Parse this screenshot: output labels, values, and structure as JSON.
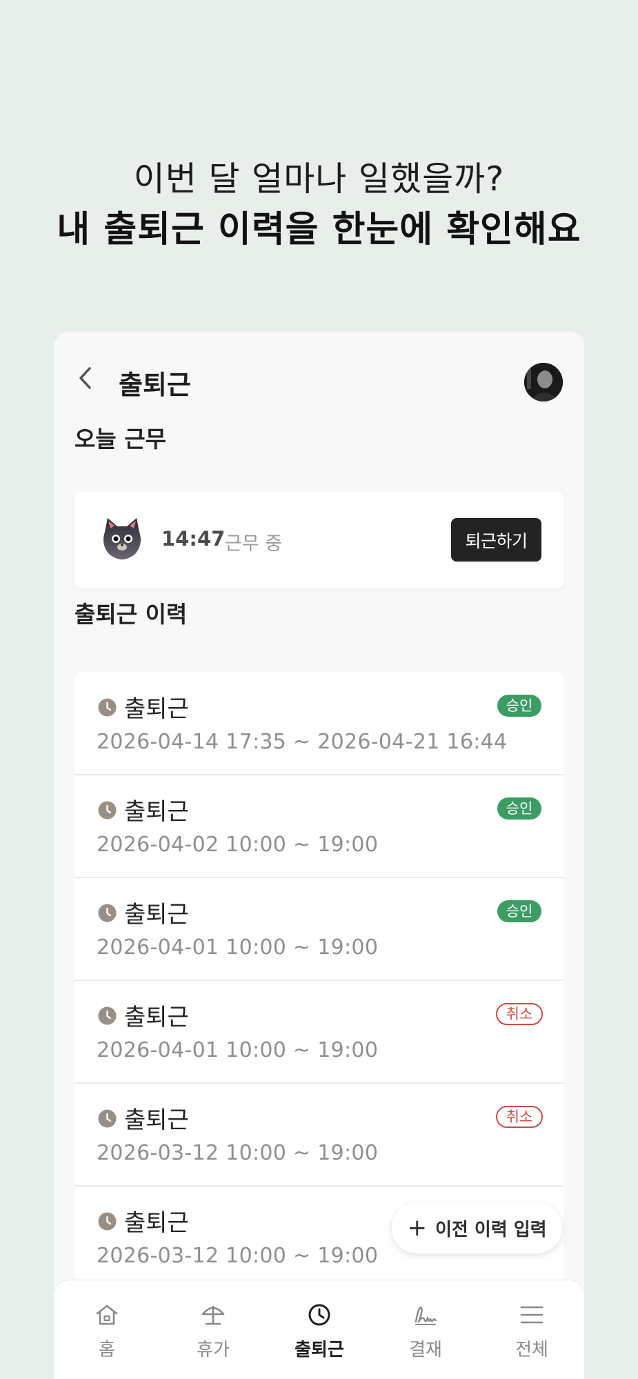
{
  "headline": {
    "line1": "이번 달 얼마나 일했을까?",
    "line2": "내 출퇴근 이력을 한눈에 확인해요"
  },
  "header": {
    "title": "출퇴근"
  },
  "today": {
    "section_title": "오늘 근무",
    "time": "14:47",
    "status": "근무 중",
    "leave_button": "퇴근하기"
  },
  "history": {
    "section_title": "출퇴근 이력",
    "rows": [
      {
        "title": "출퇴근",
        "date": "2026-04-14 17:35 ~ 2026-04-21 16:44",
        "badge": "승인",
        "badge_type": "approved"
      },
      {
        "title": "출퇴근",
        "date": "2026-04-02 10:00 ~ 19:00",
        "badge": "승인",
        "badge_type": "approved"
      },
      {
        "title": "출퇴근",
        "date": "2026-04-01 10:00 ~ 19:00",
        "badge": "승인",
        "badge_type": "approved"
      },
      {
        "title": "출퇴근",
        "date": "2026-04-01 10:00 ~ 19:00",
        "badge": "취소",
        "badge_type": "cancel"
      },
      {
        "title": "출퇴근",
        "date": "2026-03-12 10:00 ~ 19:00",
        "badge": "취소",
        "badge_type": "cancel"
      },
      {
        "title": "출퇴근",
        "date": "2026-03-12 10:00 ~ 19:00",
        "badge": "",
        "badge_type": ""
      }
    ]
  },
  "fab": {
    "plus": "+",
    "label": "이전 이력 입력"
  },
  "tabs": [
    {
      "label": "홈",
      "icon": "home-icon"
    },
    {
      "label": "휴가",
      "icon": "umbrella-icon"
    },
    {
      "label": "출퇴근",
      "icon": "clock-icon"
    },
    {
      "label": "결재",
      "icon": "signature-icon"
    },
    {
      "label": "전체",
      "icon": "menu-icon"
    }
  ],
  "colors": {
    "background": "#e8eeea",
    "approved": "#3c9c64",
    "cancel": "#d5463f",
    "dark_button": "#232323"
  }
}
